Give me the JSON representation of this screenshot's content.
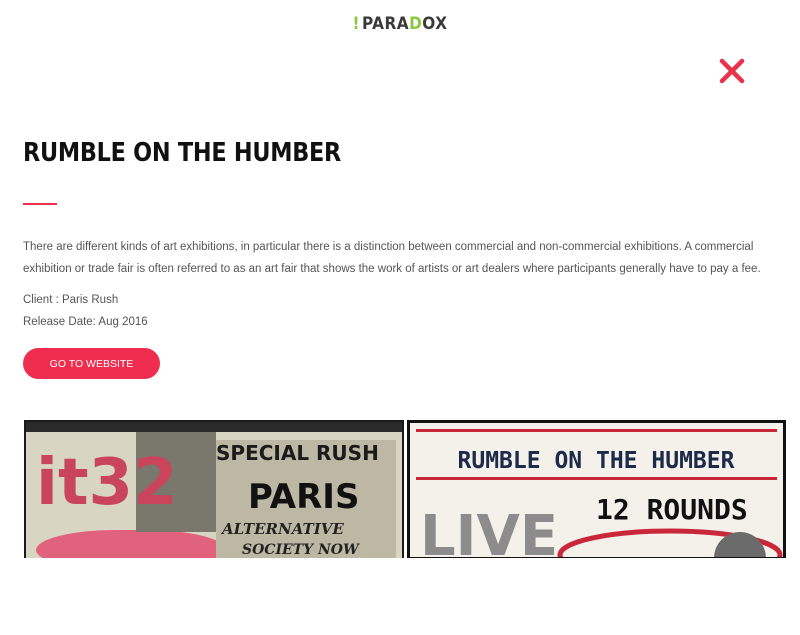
{
  "header": {
    "logo_prefix": "PARA",
    "logo_o": "D",
    "logo_suffix": "OX",
    "logo_alt": "PARADOX"
  },
  "project": {
    "title": "RUMBLE ON THE HUMBER",
    "description": "There are different kinds of art exhibitions, in particular there is a distinction between commercial and non-commercial exhibitions. A commercial exhibition or trade fair is often referred to as an art fair that shows the work of artists or art dealers where participants generally have to pay a fee.",
    "client": "Client : Paris Rush",
    "release": "Release Date: Aug 2016",
    "cta": "GO TO WEBSITE"
  },
  "gallery": {
    "poster1": {
      "big": "it32",
      "line1": "SPECIAL RUSH",
      "line2": "PARIS",
      "line3": "ALTERNATIVE",
      "line4": "SOCIETY NOW"
    },
    "poster2": {
      "headline": "RUMBLE ON THE HUMBER",
      "live": "LIVE",
      "rounds": "12 ROUNDS"
    }
  },
  "colors": {
    "accent": "#ef2d4f",
    "logo_green": "#8cc63f",
    "close": "#e8334a"
  }
}
